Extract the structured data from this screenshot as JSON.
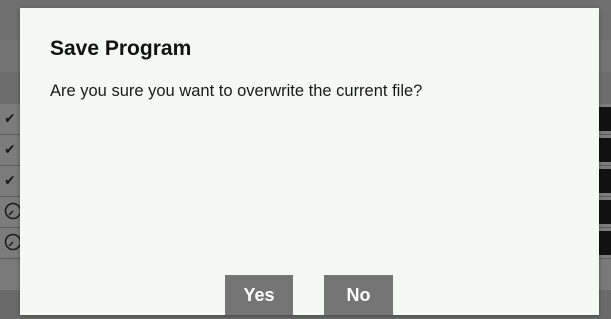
{
  "dialog": {
    "title": "Save Program",
    "message": "Are you sure you want to overwrite the current file?",
    "yes_label": "Yes",
    "no_label": "No"
  },
  "background": {
    "row_icons": [
      "checkmark-icon",
      "checkmark-icon",
      "checkmark-icon",
      "clock-icon",
      "clock-icon"
    ]
  },
  "colors": {
    "dialog_bg": "#f5f9f5",
    "button_bg": "#757575",
    "overlay": "#7a7a7a"
  }
}
